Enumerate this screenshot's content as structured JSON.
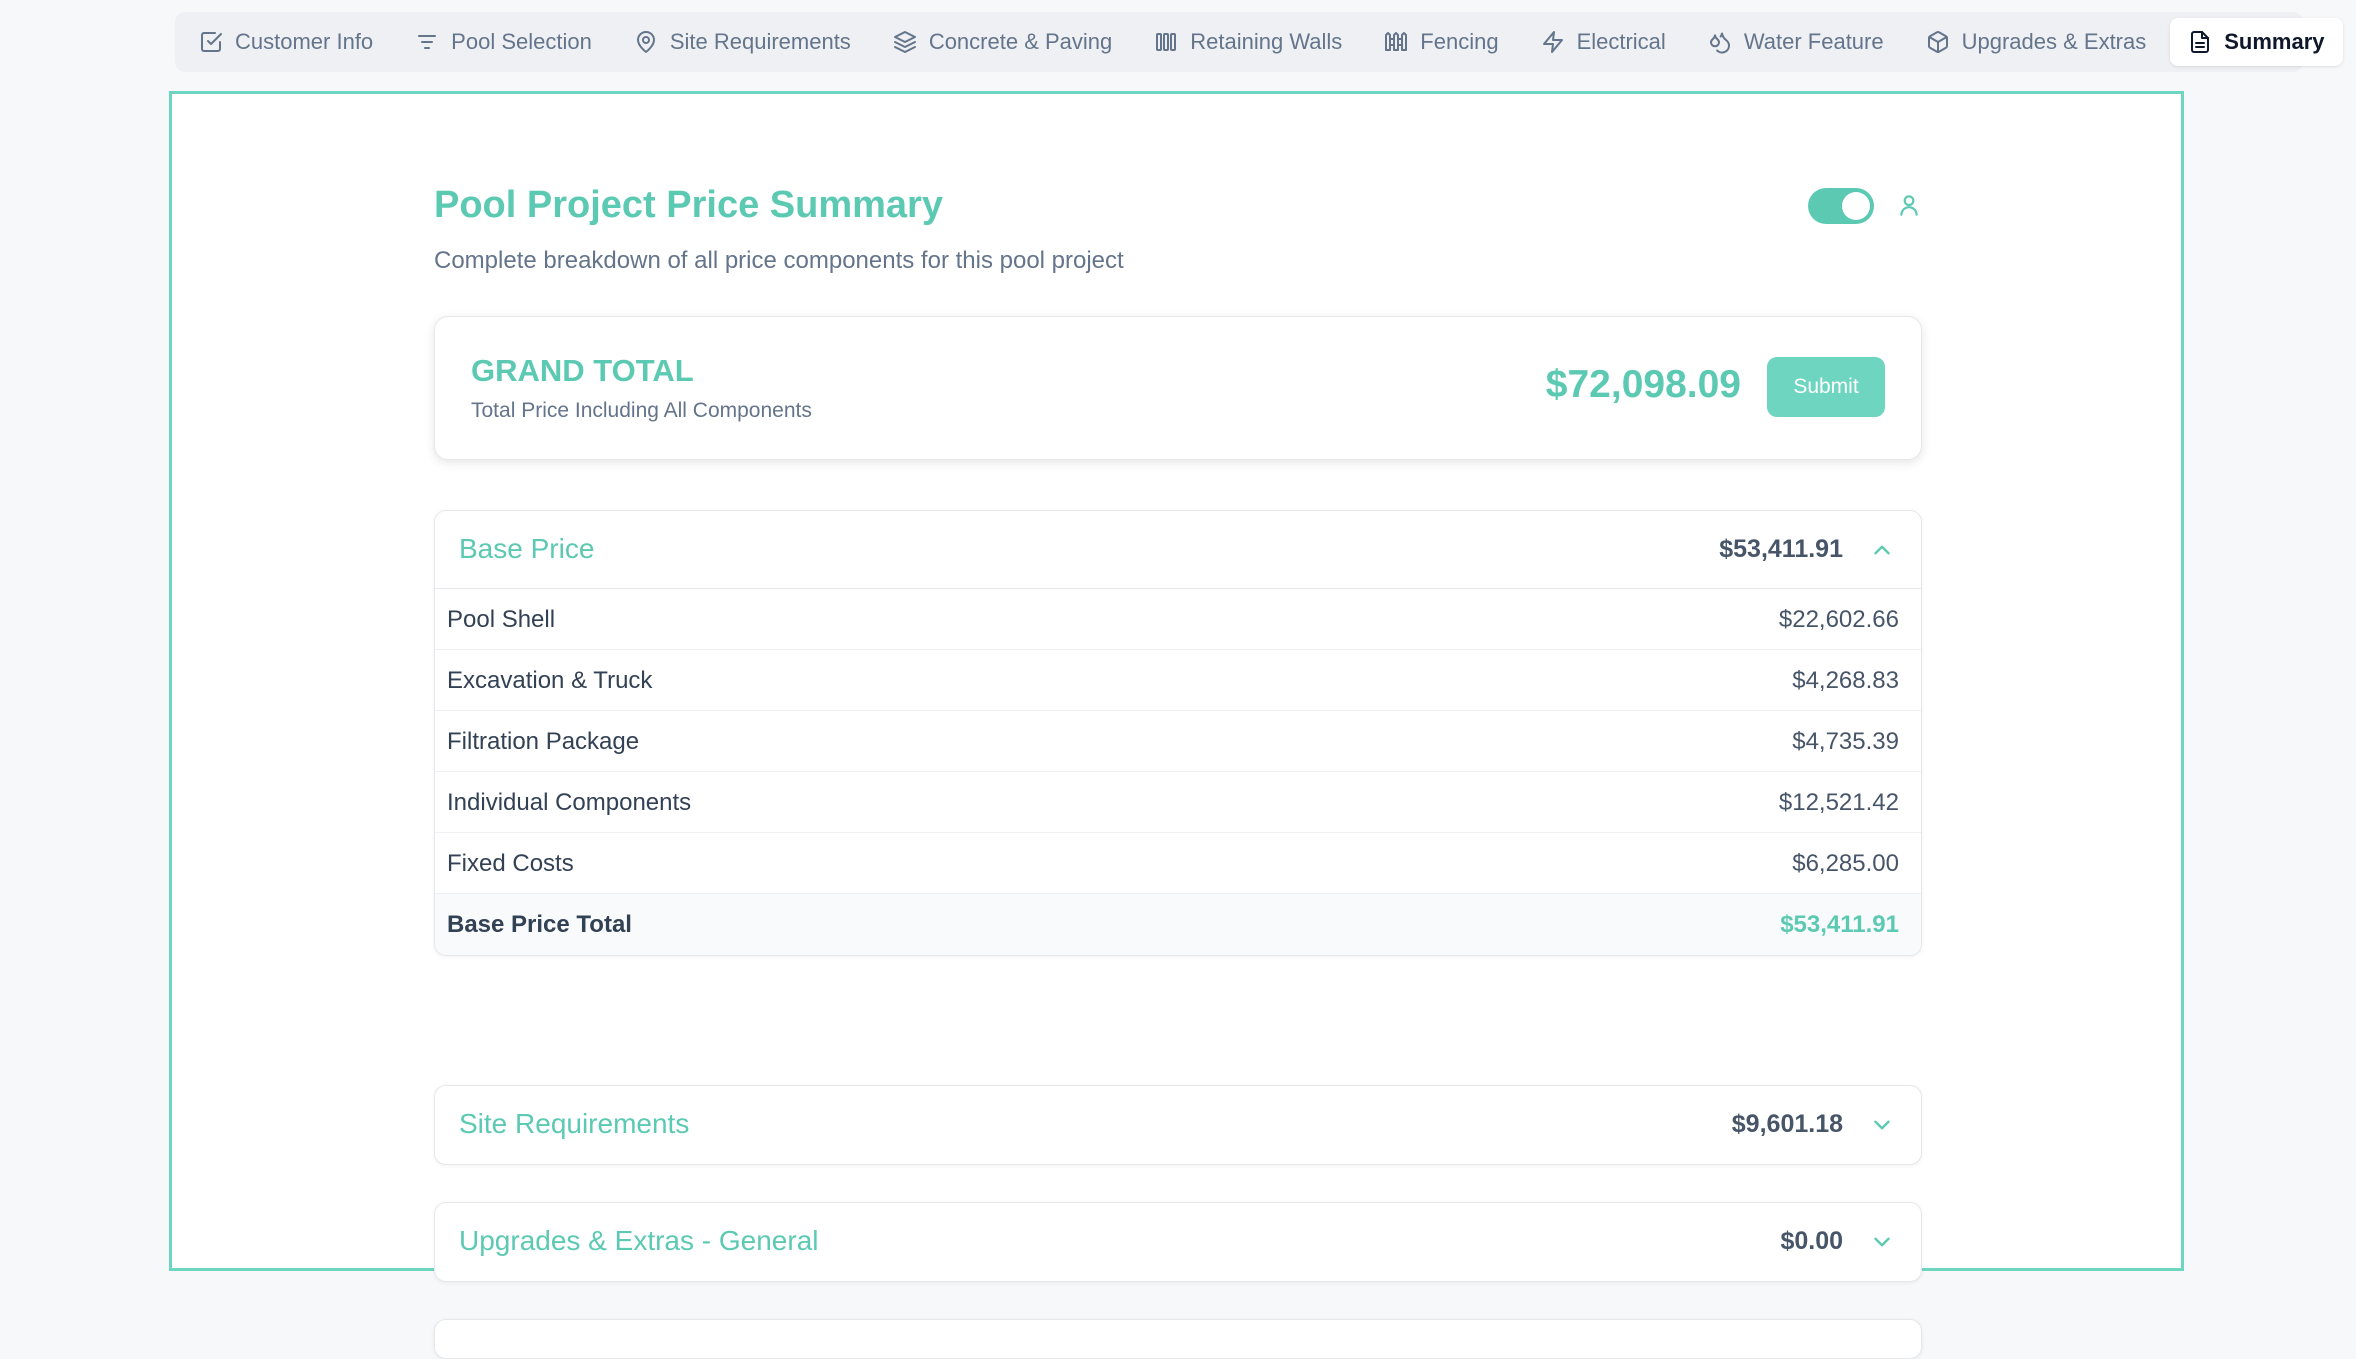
{
  "tabs": [
    {
      "label": "Customer Info",
      "icon": "checkbox-icon"
    },
    {
      "label": "Pool Selection",
      "icon": "filter-icon"
    },
    {
      "label": "Site Requirements",
      "icon": "map-pin-icon"
    },
    {
      "label": "Concrete & Paving",
      "icon": "layers-icon"
    },
    {
      "label": "Retaining Walls",
      "icon": "wall-icon"
    },
    {
      "label": "Fencing",
      "icon": "fence-icon"
    },
    {
      "label": "Electrical",
      "icon": "lightning-icon"
    },
    {
      "label": "Water Feature",
      "icon": "droplets-icon"
    },
    {
      "label": "Upgrades & Extras",
      "icon": "package-icon"
    },
    {
      "label": "Summary",
      "icon": "document-icon",
      "active": true
    }
  ],
  "summary": {
    "title": "Pool Project Price Summary",
    "subtitle": "Complete breakdown of all price components for this pool project",
    "toggle_on": true
  },
  "grand_total": {
    "label": "GRAND TOTAL",
    "sublabel": "Total Price Including All Components",
    "amount": "$72,098.09",
    "submit_label": "Submit"
  },
  "sections": [
    {
      "title": "Base Price",
      "amount": "$53,411.91",
      "expanded": true,
      "items": [
        {
          "label": "Pool Shell",
          "value": "$22,602.66"
        },
        {
          "label": "Excavation & Truck",
          "value": "$4,268.83"
        },
        {
          "label": "Filtration Package",
          "value": "$4,735.39"
        },
        {
          "label": "Individual Components",
          "value": "$12,521.42"
        },
        {
          "label": "Fixed Costs",
          "value": "$6,285.00"
        }
      ],
      "total_label": "Base Price Total",
      "total_value": "$53,411.91"
    },
    {
      "title": "Site Requirements",
      "amount": "$9,601.18",
      "expanded": false
    },
    {
      "title": "Upgrades & Extras - General",
      "amount": "$0.00",
      "expanded": false
    }
  ],
  "colors": {
    "accent": "#5cc9b3",
    "panel_border": "#6dd5c0",
    "text_muted": "#64748b"
  }
}
